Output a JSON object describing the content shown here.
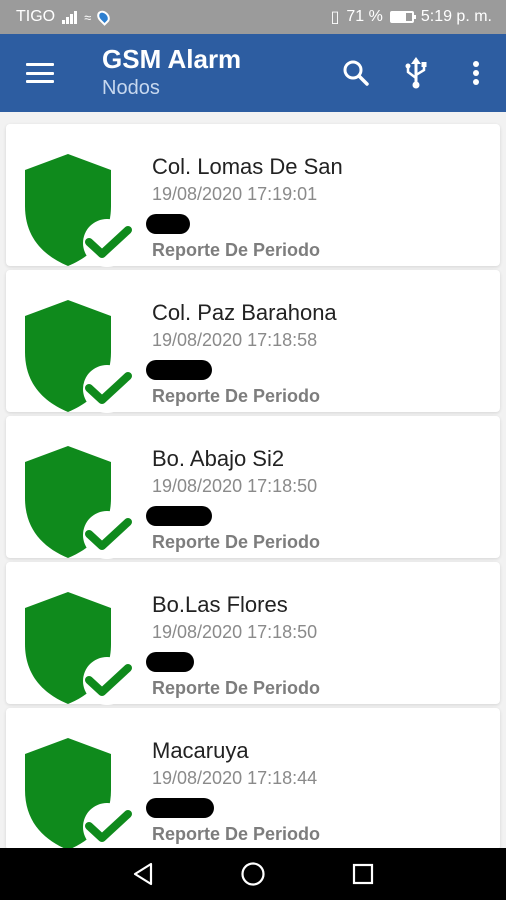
{
  "status_bar": {
    "carrier": "TIGO",
    "battery_text": "71 %",
    "battery_level": 0.71,
    "time": "5:19 p. m."
  },
  "app_bar": {
    "title": "GSM Alarm",
    "subtitle": "Nodos",
    "icons": [
      "menu-icon",
      "search-icon",
      "usb-icon",
      "more-vert-icon"
    ]
  },
  "nodes": [
    {
      "name": "Col. Lomas De San",
      "timestamp": "19/08/2020 17:19:01",
      "report": "Reporte De Periodo",
      "status_icon": "shield-check-icon"
    },
    {
      "name": "Col. Paz Barahona",
      "timestamp": "19/08/2020 17:18:58",
      "report": "Reporte De Periodo",
      "status_icon": "shield-check-icon"
    },
    {
      "name": "Bo. Abajo Si2",
      "timestamp": "19/08/2020 17:18:50",
      "report": "Reporte De Periodo",
      "status_icon": "shield-check-icon"
    },
    {
      "name": "Bo.Las Flores",
      "timestamp": "19/08/2020 17:18:50",
      "report": "Reporte De Periodo",
      "status_icon": "shield-check-icon"
    },
    {
      "name": "Macaruya",
      "timestamp": "19/08/2020 17:18:44",
      "report": "Reporte De Periodo",
      "status_icon": "shield-check-icon"
    }
  ],
  "colors": {
    "app_bar": "#2d5da1",
    "status_bar": "#9b9b9b",
    "shield": "#0f8a1c",
    "background": "#f2f2f2"
  },
  "nav_bar": {
    "icons": [
      "back-icon",
      "home-icon",
      "recents-icon"
    ]
  }
}
